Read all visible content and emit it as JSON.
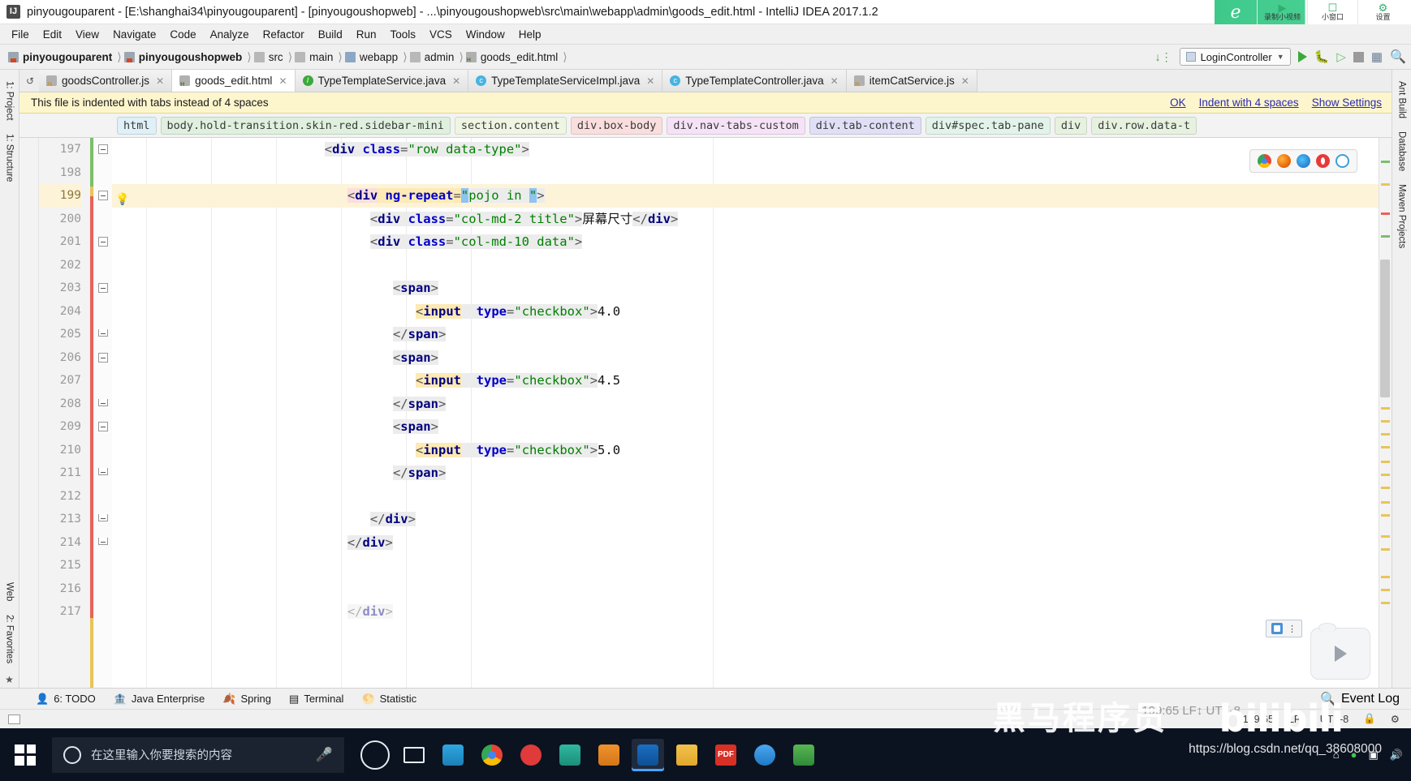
{
  "window": {
    "title": "pinyougouparent - [E:\\shanghai34\\pinyougouparent] - [pinyougoushopweb] - ...\\pinyougoushopweb\\src\\main\\webapp\\admin\\goods_edit.html - IntelliJ IDEA 2017.1.2",
    "app_icon": "IJ"
  },
  "recorder": {
    "logo": "e",
    "items": [
      {
        "icon": "record-video-icon",
        "glyph": "▶",
        "label": "录制小视频"
      },
      {
        "icon": "mini-window-icon",
        "glyph": "☐",
        "label": "小窗口"
      },
      {
        "icon": "gear-icon",
        "glyph": "⚙",
        "label": "设置"
      }
    ]
  },
  "menubar": [
    "File",
    "Edit",
    "View",
    "Navigate",
    "Code",
    "Analyze",
    "Refactor",
    "Build",
    "Run",
    "Tools",
    "VCS",
    "Window",
    "Help"
  ],
  "breadcrumb": [
    {
      "label": "pinyougouparent",
      "icon": "module-icon",
      "bold": true
    },
    {
      "label": "pinyougoushopweb",
      "icon": "module-icon",
      "bold": true
    },
    {
      "label": "src",
      "icon": "folder-icon",
      "bold": false
    },
    {
      "label": "main",
      "icon": "folder-icon",
      "bold": false
    },
    {
      "label": "webapp",
      "icon": "folder-blue-icon",
      "bold": false
    },
    {
      "label": "admin",
      "icon": "folder-icon",
      "bold": false
    },
    {
      "label": "goods_edit.html",
      "icon": "html-file-icon",
      "bold": false
    }
  ],
  "toolbar_right": {
    "sort_icon": "sort-numeric-icon",
    "run_config": "LoginController",
    "run_icon": "run-icon",
    "debug_icon": "debug-icon",
    "coverage_icon": "run-with-coverage-icon",
    "stop_icon": "stop-icon",
    "db_icon": "database-icon",
    "search_icon": "search-everywhere-icon"
  },
  "left_rail": [
    {
      "label": "1: Project",
      "name": "tool-project"
    },
    {
      "label": "1: Structure",
      "name": "tool-structure"
    },
    {
      "label": "2: Favorites",
      "name": "tool-favorites"
    },
    {
      "label": "Web",
      "name": "tool-web"
    }
  ],
  "right_rail": [
    {
      "label": "Ant Build",
      "name": "tool-ant-build"
    },
    {
      "label": "Database",
      "name": "tool-database"
    },
    {
      "label": "Maven Projects",
      "name": "tool-maven-projects"
    }
  ],
  "tabs": [
    {
      "label": "goodsController.js",
      "icon": "js-file-icon",
      "active": false
    },
    {
      "label": "goods_edit.html",
      "icon": "html-file-icon",
      "active": true
    },
    {
      "label": "TypeTemplateService.java",
      "icon": "interface-icon",
      "active": false
    },
    {
      "label": "TypeTemplateServiceImpl.java",
      "icon": "class-icon",
      "active": false
    },
    {
      "label": "TypeTemplateController.java",
      "icon": "class-icon",
      "active": false
    },
    {
      "label": "itemCatService.js",
      "icon": "js-file-icon",
      "active": false
    }
  ],
  "notification": {
    "message": "This file is indented with tabs instead of 4 spaces",
    "actions": [
      "OK",
      "Indent with 4 spaces",
      "Show Settings"
    ]
  },
  "structure_crumbs": [
    {
      "label": "html",
      "color": "blue"
    },
    {
      "label": "body.hold-transition.skin-red.sidebar-mini",
      "color": "green"
    },
    {
      "label": "section.content",
      "color": "lgreen"
    },
    {
      "label": "div.box-body",
      "color": "pink"
    },
    {
      "label": "div.nav-tabs-custom",
      "color": "violet"
    },
    {
      "label": "div.tab-content",
      "color": "lav"
    },
    {
      "label": "div#spec.tab-pane",
      "color": "mint"
    },
    {
      "label": "div",
      "color": "gn2"
    },
    {
      "label": "div.row.data-t",
      "color": "gn2"
    }
  ],
  "editor": {
    "first_line": 197,
    "lines": [
      {
        "num": 197,
        "indent": 28,
        "highlight": false,
        "fold": "start",
        "tokens": [
          {
            "t": "<",
            "c": "brk",
            "bg": "soft"
          },
          {
            "t": "div",
            "c": "tag",
            "bg": "soft"
          },
          {
            "t": " ",
            "c": "txt",
            "bg": "soft"
          },
          {
            "t": "class",
            "c": "attr",
            "bg": "soft"
          },
          {
            "t": "=",
            "c": "brk",
            "bg": "soft"
          },
          {
            "t": "\"row data-type\"",
            "c": "val",
            "bg": "soft"
          },
          {
            "t": ">",
            "c": "brk",
            "bg": "soft"
          }
        ]
      },
      {
        "num": 198,
        "indent": 0,
        "highlight": false,
        "fold": "",
        "tokens": []
      },
      {
        "num": 199,
        "indent": 31,
        "highlight": true,
        "fold": "start",
        "bulb": true,
        "tokens": [
          {
            "t": "<",
            "c": "brk",
            "bg": "pink"
          },
          {
            "t": "div",
            "c": "tag",
            "bg": "pink"
          },
          {
            "t": " ",
            "c": "txt",
            "bg": "amber"
          },
          {
            "t": "ng-repeat",
            "c": "attr",
            "bg": "amber"
          },
          {
            "t": "=",
            "c": "brk",
            "bg": "amber"
          },
          {
            "t": "\"",
            "c": "val",
            "bg": "sel"
          },
          {
            "t": "pojo in ",
            "c": "val",
            "bg": "soft"
          },
          {
            "t": "\"",
            "c": "val",
            "bg": "sel"
          },
          {
            "t": ">",
            "c": "brk",
            "bg": "soft"
          }
        ]
      },
      {
        "num": 200,
        "indent": 34,
        "highlight": false,
        "fold": "",
        "tokens": [
          {
            "t": "<",
            "c": "brk",
            "bg": "soft"
          },
          {
            "t": "div",
            "c": "tag",
            "bg": "soft"
          },
          {
            "t": " ",
            "c": "txt",
            "bg": "soft"
          },
          {
            "t": "class",
            "c": "attr",
            "bg": "soft"
          },
          {
            "t": "=",
            "c": "brk",
            "bg": "soft"
          },
          {
            "t": "\"col-md-2 title\"",
            "c": "val",
            "bg": "soft"
          },
          {
            "t": ">",
            "c": "brk",
            "bg": "soft"
          },
          {
            "t": "屏幕尺寸",
            "c": "txt",
            "bg": ""
          },
          {
            "t": "</",
            "c": "brk",
            "bg": "soft"
          },
          {
            "t": "div",
            "c": "tag",
            "bg": "soft"
          },
          {
            "t": ">",
            "c": "brk",
            "bg": "soft"
          }
        ]
      },
      {
        "num": 201,
        "indent": 34,
        "highlight": false,
        "fold": "start",
        "tokens": [
          {
            "t": "<",
            "c": "brk",
            "bg": "soft"
          },
          {
            "t": "div",
            "c": "tag",
            "bg": "soft"
          },
          {
            "t": " ",
            "c": "txt",
            "bg": "soft"
          },
          {
            "t": "class",
            "c": "attr",
            "bg": "soft"
          },
          {
            "t": "=",
            "c": "brk",
            "bg": "soft"
          },
          {
            "t": "\"col-md-10 data\"",
            "c": "val",
            "bg": "soft"
          },
          {
            "t": ">",
            "c": "brk",
            "bg": "soft"
          }
        ]
      },
      {
        "num": 202,
        "indent": 0,
        "highlight": false,
        "fold": "",
        "tokens": []
      },
      {
        "num": 203,
        "indent": 37,
        "highlight": false,
        "fold": "start",
        "tokens": [
          {
            "t": "<",
            "c": "brk",
            "bg": "soft"
          },
          {
            "t": "span",
            "c": "tag",
            "bg": "soft"
          },
          {
            "t": ">",
            "c": "brk",
            "bg": "soft"
          }
        ]
      },
      {
        "num": 204,
        "indent": 40,
        "highlight": false,
        "fold": "",
        "tokens": [
          {
            "t": "<",
            "c": "brk",
            "bg": "amber"
          },
          {
            "t": "input",
            "c": "tag",
            "bg": "amber"
          },
          {
            "t": "  ",
            "c": "txt",
            "bg": "soft"
          },
          {
            "t": "type",
            "c": "attr",
            "bg": "soft"
          },
          {
            "t": "=",
            "c": "brk",
            "bg": "soft"
          },
          {
            "t": "\"checkbox\"",
            "c": "val",
            "bg": "soft"
          },
          {
            "t": ">",
            "c": "brk",
            "bg": "soft"
          },
          {
            "t": "4.0",
            "c": "txt",
            "bg": ""
          }
        ]
      },
      {
        "num": 205,
        "indent": 37,
        "highlight": false,
        "fold": "end",
        "tokens": [
          {
            "t": "</",
            "c": "brk",
            "bg": "soft"
          },
          {
            "t": "span",
            "c": "tag",
            "bg": "soft"
          },
          {
            "t": ">",
            "c": "brk",
            "bg": "soft"
          }
        ]
      },
      {
        "num": 206,
        "indent": 37,
        "highlight": false,
        "fold": "start",
        "tokens": [
          {
            "t": "<",
            "c": "brk",
            "bg": "soft"
          },
          {
            "t": "span",
            "c": "tag",
            "bg": "soft"
          },
          {
            "t": ">",
            "c": "brk",
            "bg": "soft"
          }
        ]
      },
      {
        "num": 207,
        "indent": 40,
        "highlight": false,
        "fold": "",
        "tokens": [
          {
            "t": "<",
            "c": "brk",
            "bg": "amber"
          },
          {
            "t": "input",
            "c": "tag",
            "bg": "amber"
          },
          {
            "t": "  ",
            "c": "txt",
            "bg": "soft"
          },
          {
            "t": "type",
            "c": "attr",
            "bg": "soft"
          },
          {
            "t": "=",
            "c": "brk",
            "bg": "soft"
          },
          {
            "t": "\"checkbox\"",
            "c": "val",
            "bg": "soft"
          },
          {
            "t": ">",
            "c": "brk",
            "bg": "soft"
          },
          {
            "t": "4.5",
            "c": "txt",
            "bg": ""
          }
        ]
      },
      {
        "num": 208,
        "indent": 37,
        "highlight": false,
        "fold": "end",
        "tokens": [
          {
            "t": "</",
            "c": "brk",
            "bg": "soft"
          },
          {
            "t": "span",
            "c": "tag",
            "bg": "soft"
          },
          {
            "t": ">",
            "c": "brk",
            "bg": "soft"
          }
        ]
      },
      {
        "num": 209,
        "indent": 37,
        "highlight": false,
        "fold": "start",
        "tokens": [
          {
            "t": "<",
            "c": "brk",
            "bg": "soft"
          },
          {
            "t": "span",
            "c": "tag",
            "bg": "soft"
          },
          {
            "t": ">",
            "c": "brk",
            "bg": "soft"
          }
        ]
      },
      {
        "num": 210,
        "indent": 40,
        "highlight": false,
        "fold": "",
        "tokens": [
          {
            "t": "<",
            "c": "brk",
            "bg": "amber"
          },
          {
            "t": "input",
            "c": "tag",
            "bg": "amber"
          },
          {
            "t": "  ",
            "c": "txt",
            "bg": "soft"
          },
          {
            "t": "type",
            "c": "attr",
            "bg": "soft"
          },
          {
            "t": "=",
            "c": "brk",
            "bg": "soft"
          },
          {
            "t": "\"checkbox\"",
            "c": "val",
            "bg": "soft"
          },
          {
            "t": ">",
            "c": "brk",
            "bg": "soft"
          },
          {
            "t": "5.0",
            "c": "txt",
            "bg": ""
          }
        ]
      },
      {
        "num": 211,
        "indent": 37,
        "highlight": false,
        "fold": "end",
        "tokens": [
          {
            "t": "</",
            "c": "brk",
            "bg": "soft"
          },
          {
            "t": "span",
            "c": "tag",
            "bg": "soft"
          },
          {
            "t": ">",
            "c": "brk",
            "bg": "soft"
          }
        ]
      },
      {
        "num": 212,
        "indent": 0,
        "highlight": false,
        "fold": "",
        "tokens": []
      },
      {
        "num": 213,
        "indent": 34,
        "highlight": false,
        "fold": "end",
        "tokens": [
          {
            "t": "</",
            "c": "brk",
            "bg": "soft"
          },
          {
            "t": "div",
            "c": "tag",
            "bg": "soft"
          },
          {
            "t": ">",
            "c": "brk",
            "bg": "soft"
          }
        ]
      },
      {
        "num": 214,
        "indent": 31,
        "highlight": false,
        "fold": "end",
        "tokens": [
          {
            "t": "</",
            "c": "brk",
            "bg": "soft"
          },
          {
            "t": "div",
            "c": "tag",
            "bg": "soft"
          },
          {
            "t": ">",
            "c": "brk",
            "bg": "soft"
          }
        ]
      },
      {
        "num": 215,
        "indent": 0,
        "highlight": false,
        "fold": "",
        "tokens": []
      },
      {
        "num": 216,
        "indent": 0,
        "highlight": false,
        "fold": "",
        "tokens": []
      },
      {
        "num": 217,
        "indent": 31,
        "highlight": false,
        "fold": "",
        "faded": true,
        "tokens": [
          {
            "t": "</",
            "c": "brk",
            "bg": "soft"
          },
          {
            "t": "div",
            "c": "tag",
            "bg": "soft"
          },
          {
            "t": ">",
            "c": "brk",
            "bg": "soft"
          }
        ]
      }
    ]
  },
  "preview_browsers": [
    {
      "name": "chrome-icon"
    },
    {
      "name": "firefox-icon"
    },
    {
      "name": "edge-icon"
    },
    {
      "name": "opera-icon"
    },
    {
      "name": "ie-icon"
    }
  ],
  "bottom_tools": [
    {
      "label": "6: TODO",
      "icon": "todo-icon",
      "mnemonic": "6"
    },
    {
      "label": "Java Enterprise",
      "icon": "java-enterprise-icon"
    },
    {
      "label": "Spring",
      "icon": "spring-leaf-icon"
    },
    {
      "label": "Terminal",
      "icon": "terminal-icon"
    },
    {
      "label": "Statistic",
      "icon": "statistic-icon"
    }
  ],
  "bottom_right": {
    "label": "Event Log",
    "icon": "event-log-icon"
  },
  "statusbar": {
    "caret": "199:65",
    "line_sep": "LF↕",
    "encoding": "UTF-8",
    "lock_icon": "lock-icon",
    "inspection_icon": "inspections-icon"
  },
  "taskbar": {
    "search_placeholder": "在这里输入你要搜索的内容",
    "start_icon": "windows-start-icon",
    "mic_icon": "microphone-icon",
    "cortana_icon": "cortana-icon",
    "taskview_icon": "task-view-icon",
    "apps": [
      {
        "name": "photoshop-icon"
      },
      {
        "name": "chrome-icon"
      },
      {
        "name": "recorder-icon"
      },
      {
        "name": "sublime-icon"
      },
      {
        "name": "filezilla-icon"
      },
      {
        "name": "intellij-idea-icon",
        "active": true
      },
      {
        "name": "file-explorer-icon"
      },
      {
        "name": "pdf-reader-icon"
      },
      {
        "name": "wechat-icon"
      },
      {
        "name": "excel-icon"
      }
    ]
  },
  "watermarks": {
    "brand": "黑马程序员",
    "platform": "bilibili",
    "url": "https://blog.csdn.net/qq_38608000"
  }
}
